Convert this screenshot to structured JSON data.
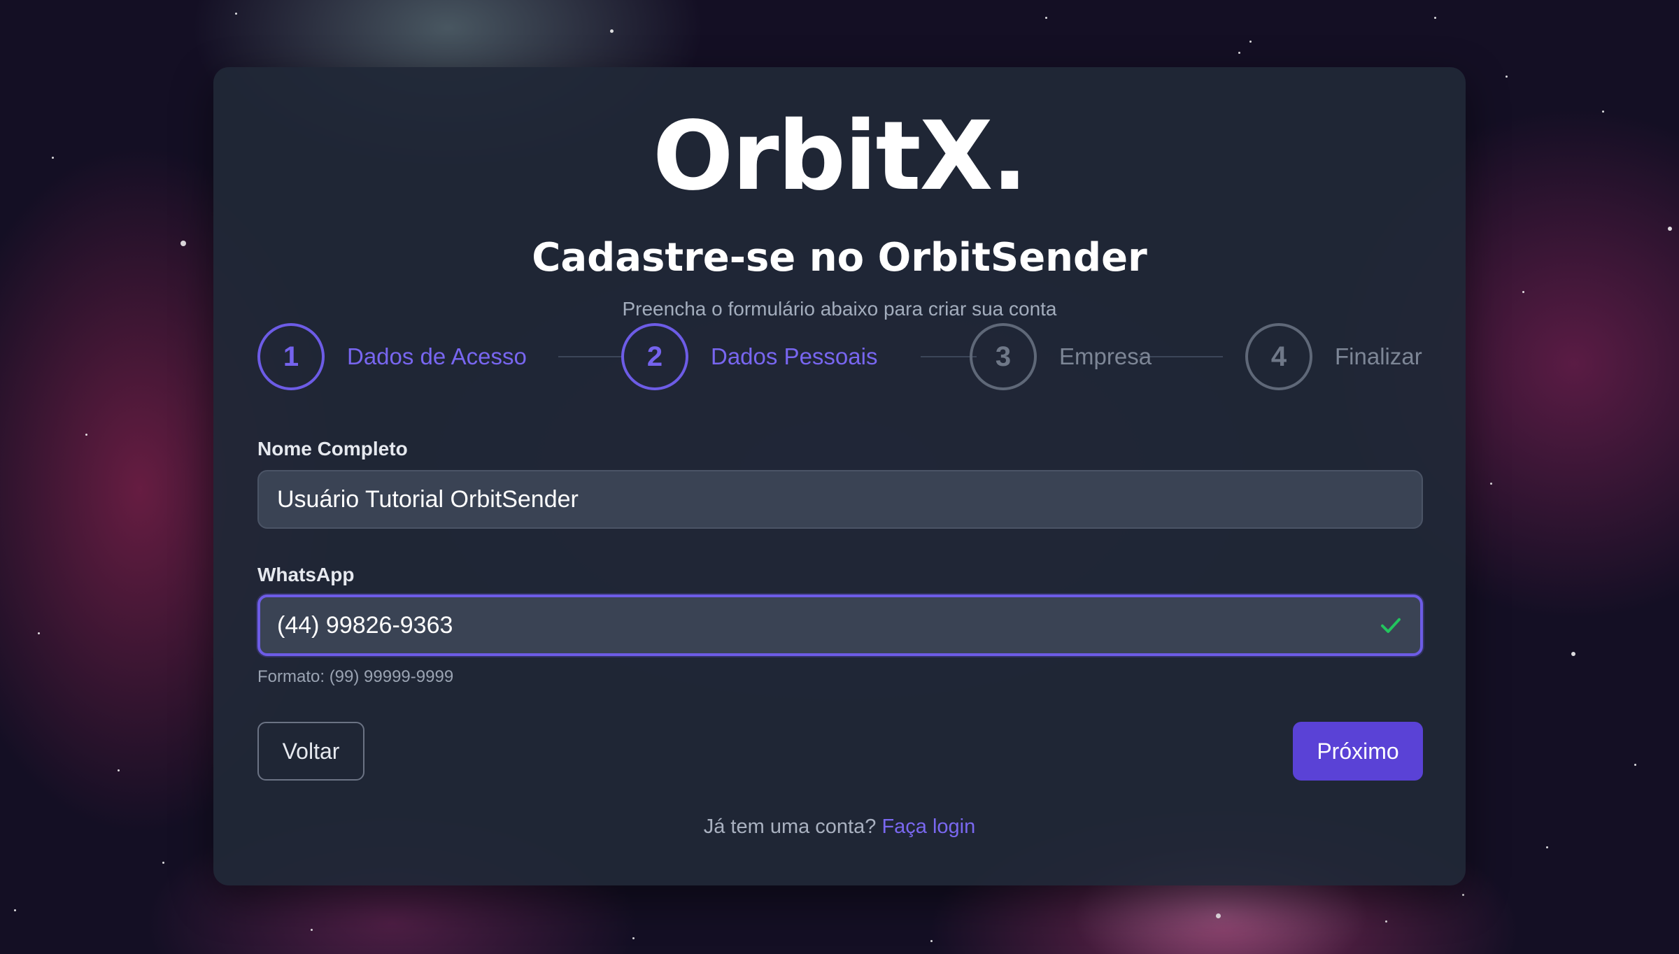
{
  "brand": {
    "logo": "OrbitX."
  },
  "header": {
    "title": "Cadastre-se no OrbitSender",
    "subtitle": "Preencha o formulário abaixo para criar sua conta"
  },
  "steps": [
    {
      "number": "1",
      "label": "Dados de Acesso",
      "state": "active"
    },
    {
      "number": "2",
      "label": "Dados Pessoais",
      "state": "active"
    },
    {
      "number": "3",
      "label": "Empresa",
      "state": "inactive"
    },
    {
      "number": "4",
      "label": "Finalizar",
      "state": "inactive"
    }
  ],
  "form": {
    "name": {
      "label": "Nome Completo",
      "value": "Usuário Tutorial OrbitSender"
    },
    "whatsapp": {
      "label": "WhatsApp",
      "value": "(44) 99826-9363",
      "hint": "Formato: (99) 99999-9999",
      "valid_icon": "check-icon"
    }
  },
  "buttons": {
    "back": "Voltar",
    "next": "Próximo"
  },
  "footer": {
    "text": "Já tem uma conta?",
    "link": "Faça login"
  },
  "colors": {
    "accent": "#6d5ce6",
    "button_primary": "#5a42d6",
    "card_bg": "#202837",
    "valid": "#22c55e"
  }
}
